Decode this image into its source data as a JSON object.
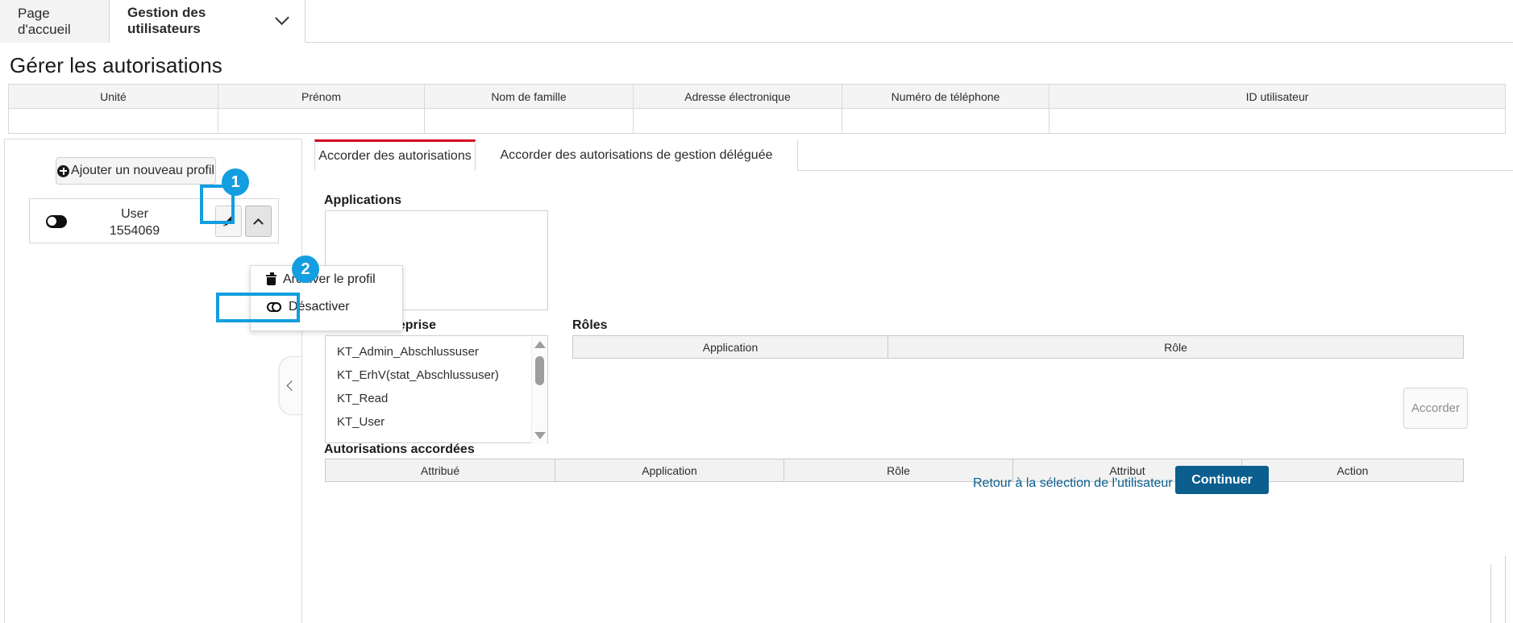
{
  "topnav": {
    "tabs": [
      {
        "label": "Page d'accueil",
        "active": false
      },
      {
        "label": "Gestion des utilisateurs",
        "active": true
      }
    ],
    "chevron_icon": "chevron-down-icon"
  },
  "page": {
    "title": "Gérer les autorisations"
  },
  "user_table": {
    "columns": [
      "Unité",
      "Prénom",
      "Nom de famille",
      "Adresse électronique",
      "Numéro de téléphone",
      "ID utilisateur"
    ],
    "rows": [
      [
        "",
        "",
        "",
        "",
        "",
        ""
      ]
    ]
  },
  "left_panel": {
    "add_profile_label": "Ajouter un nouveau profil",
    "add_profile_icon": "plus-circle-icon",
    "profile": {
      "toggle_icon": "toggle-on-icon",
      "name": "User",
      "id": "1554069",
      "edit_icon": "pencil-icon",
      "menu_icon": "chevron-up-icon"
    },
    "collapse_icon": "chevron-left-icon"
  },
  "dropdown": {
    "items": [
      {
        "label": "Archiver le profil",
        "icon": "trash-icon"
      },
      {
        "label": "Désactiver",
        "icon": "toggle-pill-icon"
      }
    ]
  },
  "annotations": [
    {
      "number": "1",
      "target": "profile-menu-button"
    },
    {
      "number": "2",
      "target": "dropdown-item-desactiver"
    }
  ],
  "tabs": [
    {
      "label": "Accorder des autorisations",
      "active": true
    },
    {
      "label": "Accorder des autorisations de gestion déléguée",
      "active": false
    }
  ],
  "applications": {
    "label": "Applications",
    "options": []
  },
  "entreprise_roles": {
    "label": "Rôles d'entreprise",
    "options": [
      "KT_Admin_Abschlussuser",
      "KT_ErhV(stat_Abschlussuser)",
      "KT_Read",
      "KT_User"
    ],
    "scroll_up_icon": "triangle-up-icon",
    "scroll_down_icon": "triangle-down-icon"
  },
  "roles": {
    "label": "Rôles",
    "columns": [
      "Application",
      "Rôle"
    ],
    "rows": []
  },
  "accorder_button": {
    "label": "Accorder",
    "enabled": false
  },
  "granted_permissions": {
    "label": "Autorisations accordées",
    "columns": [
      "Attribué",
      "Application",
      "Rôle",
      "Attribut",
      "Action"
    ],
    "rows": []
  },
  "footer": {
    "back_link": "Retour à la sélection de l'utilisateur",
    "continue_label": "Continuer"
  },
  "colors": {
    "accent_blue": "#129ee0",
    "primary_blue": "#0b5e8e",
    "active_tab_red": "#d0021b",
    "header_gray": "#f2f2f2"
  }
}
